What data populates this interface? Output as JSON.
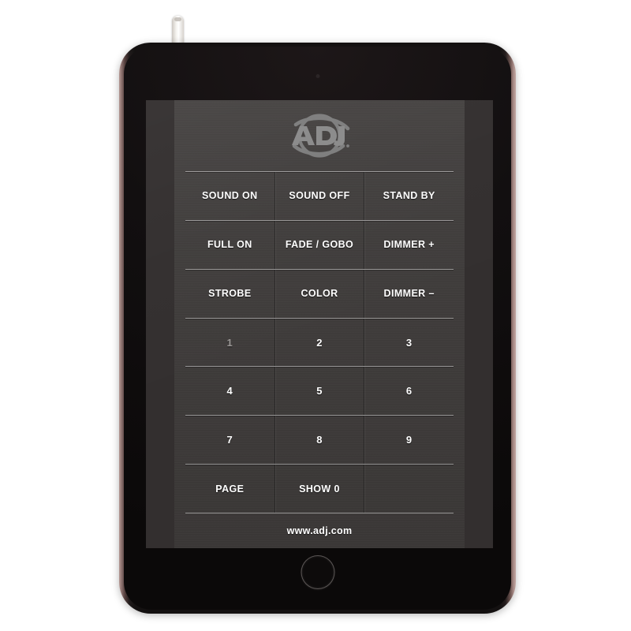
{
  "device": {
    "type": "tablet",
    "antenna_label": "antenna-dongle",
    "camera_label": "front-camera",
    "home_button_label": "home-button"
  },
  "app": {
    "brand": "ADJ",
    "logo_alt": "ADJ",
    "footer_url": "www.adj.com",
    "colors": {
      "panel_base": "#403d3c",
      "side_band": "#332f2f",
      "screen_bg": "#2c2828",
      "label": "#ffffff",
      "label_dim": "#9b9896",
      "separator": "#ebebeb",
      "logo": "#7a7a7a",
      "bezel": "#121011",
      "body_rim": "#b79a95"
    }
  },
  "keypad": {
    "rows": [
      {
        "keys": [
          {
            "label": "SOUND ON",
            "name": "key-sound-on",
            "style": "text"
          },
          {
            "label": "SOUND OFF",
            "name": "key-sound-off",
            "style": "text"
          },
          {
            "label": "STAND BY",
            "name": "key-stand-by",
            "style": "text"
          }
        ]
      },
      {
        "keys": [
          {
            "label": "FULL ON",
            "name": "key-full-on",
            "style": "text"
          },
          {
            "label": "FADE / GOBO",
            "name": "key-fade-gobo",
            "style": "text"
          },
          {
            "label": "DIMMER +",
            "name": "key-dimmer-up",
            "style": "text"
          }
        ]
      },
      {
        "keys": [
          {
            "label": "STROBE",
            "name": "key-strobe",
            "style": "text"
          },
          {
            "label": "COLOR",
            "name": "key-color",
            "style": "text"
          },
          {
            "label": "DIMMER –",
            "name": "key-dimmer-down",
            "style": "text"
          }
        ]
      },
      {
        "keys": [
          {
            "label": "1",
            "name": "key-1",
            "style": "num dim"
          },
          {
            "label": "2",
            "name": "key-2",
            "style": "num"
          },
          {
            "label": "3",
            "name": "key-3",
            "style": "num"
          }
        ]
      },
      {
        "keys": [
          {
            "label": "4",
            "name": "key-4",
            "style": "num"
          },
          {
            "label": "5",
            "name": "key-5",
            "style": "num"
          },
          {
            "label": "6",
            "name": "key-6",
            "style": "num"
          }
        ]
      },
      {
        "keys": [
          {
            "label": "7",
            "name": "key-7",
            "style": "num"
          },
          {
            "label": "8",
            "name": "key-8",
            "style": "num"
          },
          {
            "label": "9",
            "name": "key-9",
            "style": "num"
          }
        ]
      },
      {
        "keys": [
          {
            "label": "PAGE",
            "name": "key-page",
            "style": "text"
          },
          {
            "label": "SHOW 0",
            "name": "key-show-0",
            "style": "text"
          },
          {
            "label": "",
            "name": "key-blank",
            "style": "empty"
          }
        ]
      }
    ]
  }
}
